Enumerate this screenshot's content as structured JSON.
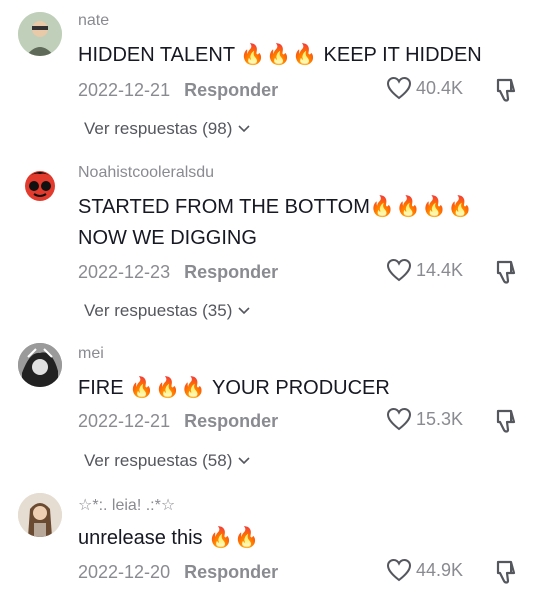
{
  "comments": [
    {
      "username": "nate",
      "text_before": "HIDDEN TALENT ",
      "fire": "🔥🔥🔥",
      "text_after": " KEEP IT HIDDEN",
      "text_line2": "",
      "date": "2022-12-21",
      "reply_label": "Responder",
      "likes": "40.4K",
      "replies_label": "Ver respuestas (98)"
    },
    {
      "username": "Noahistcooleralsdu",
      "text_before": "STARTED FROM THE BOTTOM",
      "fire": "🔥🔥🔥🔥",
      "text_after": "",
      "text_line2": "NOW WE DIGGING",
      "date": "2022-12-23",
      "reply_label": "Responder",
      "likes": "14.4K",
      "replies_label": "Ver respuestas (35)"
    },
    {
      "username": "mei",
      "text_before": "FIRE ",
      "fire": "🔥🔥🔥",
      "text_after": " YOUR PRODUCER",
      "text_line2": "",
      "date": "2022-12-21",
      "reply_label": "Responder",
      "likes": "15.3K",
      "replies_label": "Ver respuestas (58)"
    },
    {
      "username": "☆*:. leia! .:*☆",
      "text_before": "unrelease this ",
      "fire": "🔥🔥",
      "text_after": "",
      "text_line2": "",
      "date": "2022-12-20",
      "reply_label": "Responder",
      "likes": "44.9K",
      "replies_label": ""
    }
  ],
  "icons": {
    "like": "heart-outline-icon",
    "dislike": "thumbs-down-icon",
    "expand": "chevron-down-icon"
  },
  "colors": {
    "primary_text": "#161823",
    "secondary_text": "#8a8b91",
    "fire": "#ff7a00"
  }
}
